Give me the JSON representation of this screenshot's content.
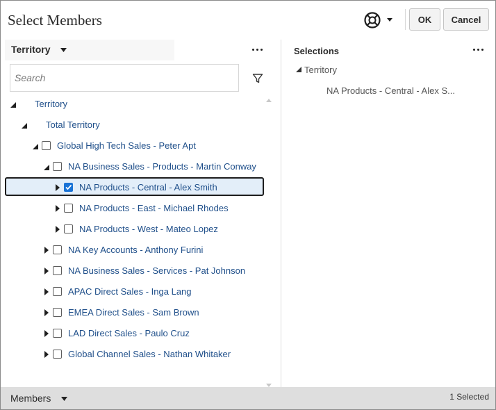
{
  "dialog": {
    "title": "Select Members",
    "ok_label": "OK",
    "cancel_label": "Cancel",
    "help_icon": "help-lifebuoy-icon"
  },
  "left_panel": {
    "dimension": "Territory",
    "search_placeholder": "Search",
    "tree": [
      {
        "label": "Territory",
        "level": 0,
        "expanded": true,
        "checkbox": false,
        "checked": false,
        "selected": false
      },
      {
        "label": "Total Territory",
        "level": 1,
        "expanded": true,
        "checkbox": false,
        "checked": false,
        "selected": false
      },
      {
        "label": "Global High Tech Sales - Peter Apt",
        "level": 2,
        "expanded": true,
        "checkbox": true,
        "checked": false,
        "selected": false
      },
      {
        "label": "NA Business Sales - Products - Martin Conway",
        "level": 3,
        "expanded": true,
        "checkbox": true,
        "checked": false,
        "selected": false
      },
      {
        "label": "NA Products - Central - Alex Smith",
        "level": 4,
        "expanded": false,
        "checkbox": true,
        "checked": true,
        "selected": true
      },
      {
        "label": "NA Products - East - Michael Rhodes",
        "level": 4,
        "expanded": false,
        "checkbox": true,
        "checked": false,
        "selected": false
      },
      {
        "label": "NA Products - West - Mateo Lopez",
        "level": 4,
        "expanded": false,
        "checkbox": true,
        "checked": false,
        "selected": false
      },
      {
        "label": "NA Key Accounts - Anthony Furini",
        "level": 3,
        "expanded": false,
        "checkbox": true,
        "checked": false,
        "selected": false
      },
      {
        "label": "NA Business Sales - Services - Pat Johnson",
        "level": 3,
        "expanded": false,
        "checkbox": true,
        "checked": false,
        "selected": false
      },
      {
        "label": "APAC Direct Sales - Inga Lang",
        "level": 3,
        "expanded": false,
        "checkbox": true,
        "checked": false,
        "selected": false
      },
      {
        "label": "EMEA Direct Sales - Sam Brown",
        "level": 3,
        "expanded": false,
        "checkbox": true,
        "checked": false,
        "selected": false
      },
      {
        "label": "LAD Direct Sales - Paulo Cruz",
        "level": 3,
        "expanded": false,
        "checkbox": true,
        "checked": false,
        "selected": false
      },
      {
        "label": "Global Channel Sales - Nathan Whitaker",
        "level": 3,
        "expanded": false,
        "checkbox": true,
        "checked": false,
        "selected": false
      }
    ]
  },
  "right_panel": {
    "title": "Selections",
    "group": "Territory",
    "items": [
      "NA Products - Central - Alex S..."
    ]
  },
  "footer": {
    "view_label": "Members",
    "selected_count": "1 Selected"
  },
  "colors": {
    "link_text": "#1f4f8a",
    "checkbox_checked": "#1a73d6",
    "selected_row_bg": "#e3eef9",
    "footer_bg": "#dedede"
  }
}
